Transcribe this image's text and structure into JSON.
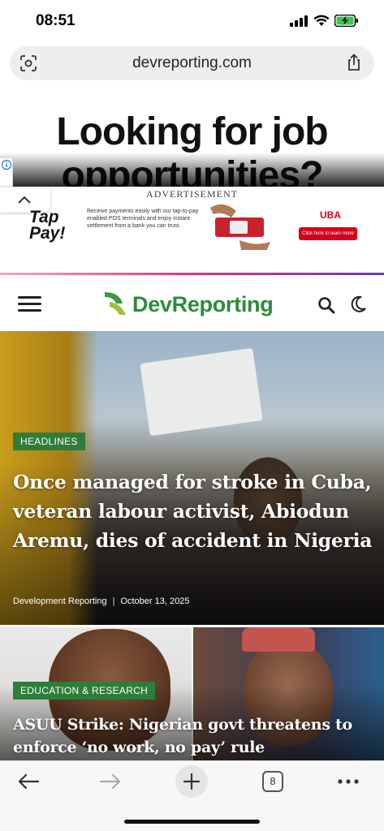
{
  "status_bar": {
    "time": "08:51"
  },
  "browser": {
    "url": "devreporting.com",
    "tab_count": "8"
  },
  "top_ad": {
    "headline": "Looking for job opportunities?"
  },
  "banner_ad": {
    "label": "ADVERTISEMENT",
    "brand_line1": "Tap",
    "brand_line2": "Pay!",
    "copy": "Receive payments easily with our tap-to-pay enabled POS terminals and enjoy instant settlement from a bank you can trust.",
    "bank": "UBA",
    "cta": "Click here to learn more"
  },
  "site_header": {
    "brand": "DevReporting"
  },
  "hero_article": {
    "category": "HEADLINES",
    "title": "Once managed for stroke in Cuba, veteran labour activist, Abiodun Aremu, dies of accident in Nigeria",
    "author": "Development Reporting",
    "separator": "|",
    "date": "October 13, 2025"
  },
  "second_article": {
    "category": "EDUCATION & RESEARCH",
    "title": "ASUU Strike: Nigerian govt threatens to enforce ‘no work, no pay’ rule"
  },
  "colors": {
    "brand_green": "#2e8b3d",
    "tag_green": "#2e7d3a",
    "uba_red": "#d6001c"
  }
}
